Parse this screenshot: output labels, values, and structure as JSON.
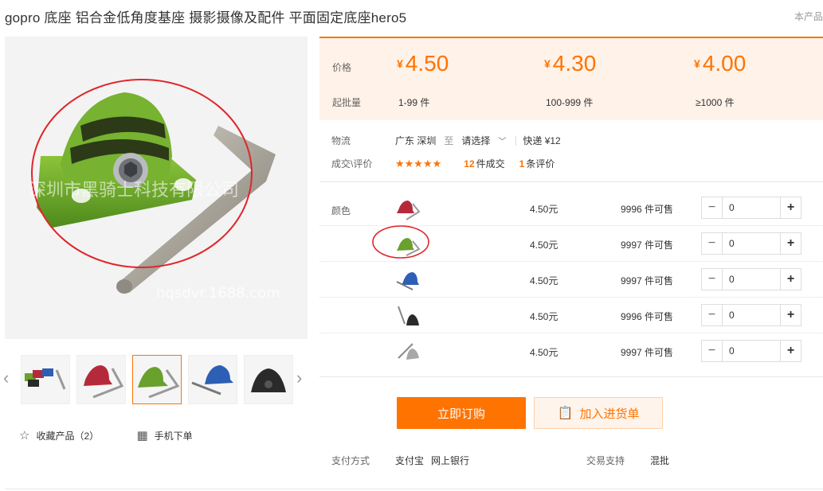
{
  "title": "gopro 底座 铝合金低角度基座 摄影摄像及配件 平面固定底座hero5",
  "title_right": "本产品",
  "main_image": {
    "watermark_cn": "深圳市黑骑士科技有限公司",
    "watermark_url": "hqsdvr.1688.com"
  },
  "price_block": {
    "price_label": "价格",
    "moq_label": "起批量",
    "currency": "¥",
    "tiers": [
      {
        "price": "4.50",
        "range": "1-99 件"
      },
      {
        "price": "4.30",
        "range": "100-999 件"
      },
      {
        "price": "4.00",
        "range": "≥1000 件"
      }
    ]
  },
  "logistics": {
    "label": "物流",
    "from": "广东 深圳",
    "to_word": "至",
    "dest_placeholder": "请选择",
    "express": "快递 ¥12"
  },
  "deals": {
    "label": "成交\\评价",
    "stars": "★★★★★",
    "deal_count": "12",
    "deal_suffix": "件成交",
    "review_count": "1",
    "review_suffix": "条评价"
  },
  "sku": {
    "label": "颜色",
    "rows": [
      {
        "color": "#b52a3a",
        "price": "4.50元",
        "stock": "9996 件可售",
        "qty": "0"
      },
      {
        "color": "#6aa02c",
        "price": "4.50元",
        "stock": "9997 件可售",
        "qty": "0"
      },
      {
        "color": "#2d5fb5",
        "price": "4.50元",
        "stock": "9997 件可售",
        "qty": "0"
      },
      {
        "color": "#2a2a2a",
        "price": "4.50元",
        "stock": "9996 件可售",
        "qty": "0"
      },
      {
        "color": "#a8a8a8",
        "price": "4.50元",
        "stock": "9997 件可售",
        "qty": "0"
      }
    ]
  },
  "buttons": {
    "order": "立即订购",
    "cart": "加入进货单"
  },
  "payment": {
    "label": "支付方式",
    "methods": [
      "支付宝",
      "网上银行"
    ],
    "trade_label": "交易支持",
    "trade_value": "混批"
  },
  "left_actions": {
    "favorite": "收藏产品（2）",
    "mobile": "手机下单"
  },
  "colors": {
    "accent": "#ff7300",
    "price_bg": "#fff2e8",
    "highlight_circle": "#e0262b"
  }
}
